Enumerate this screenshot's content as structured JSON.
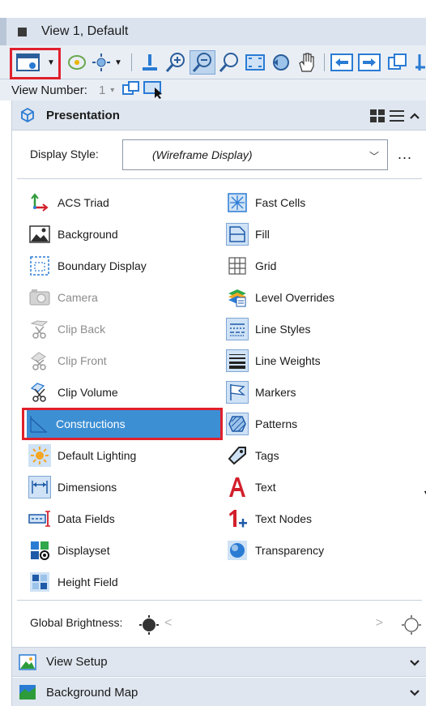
{
  "window": {
    "title": "View 1, Default"
  },
  "view_number": {
    "label": "View Number:",
    "value": "1"
  },
  "presentation": {
    "title": "Presentation",
    "display_style": {
      "label": "Display Style:",
      "value": "(Wireframe Display)"
    },
    "more_label": "...",
    "left_items": [
      {
        "label": "ACS Triad",
        "icon": "acs-triad-icon",
        "disabled": false
      },
      {
        "label": "Background",
        "icon": "background-image-icon",
        "disabled": false
      },
      {
        "label": "Boundary Display",
        "icon": "boundary-display-icon",
        "disabled": false
      },
      {
        "label": "Camera",
        "icon": "camera-icon",
        "disabled": true
      },
      {
        "label": "Clip Back",
        "icon": "clip-back-icon",
        "disabled": true
      },
      {
        "label": "Clip Front",
        "icon": "clip-front-icon",
        "disabled": true
      },
      {
        "label": "Clip Volume",
        "icon": "clip-volume-icon",
        "disabled": false
      },
      {
        "label": "Constructions",
        "icon": "constructions-icon",
        "disabled": false,
        "selected": true
      },
      {
        "label": "Default Lighting",
        "icon": "lighting-icon",
        "disabled": false
      },
      {
        "label": "Dimensions",
        "icon": "dimensions-icon",
        "disabled": false
      },
      {
        "label": "Data Fields",
        "icon": "data-fields-icon",
        "disabled": false
      },
      {
        "label": "Displayset",
        "icon": "displayset-icon",
        "disabled": false
      },
      {
        "label": "Height Field",
        "icon": "height-field-icon",
        "disabled": false
      }
    ],
    "right_items": [
      {
        "label": "Fast Cells",
        "icon": "fast-cells-icon"
      },
      {
        "label": "Fill",
        "icon": "fill-icon"
      },
      {
        "label": "Grid",
        "icon": "grid-icon"
      },
      {
        "label": "Level Overrides",
        "icon": "level-overrides-icon"
      },
      {
        "label": "Line Styles",
        "icon": "line-styles-icon"
      },
      {
        "label": "Line Weights",
        "icon": "line-weights-icon"
      },
      {
        "label": "Markers",
        "icon": "markers-icon"
      },
      {
        "label": "Patterns",
        "icon": "patterns-icon"
      },
      {
        "label": "Tags",
        "icon": "tags-icon"
      },
      {
        "label": "Text",
        "icon": "text-icon"
      },
      {
        "label": "Text Nodes",
        "icon": "text-nodes-icon"
      },
      {
        "label": "Transparency",
        "icon": "transparency-icon"
      }
    ],
    "global_brightness": {
      "label": "Global Brightness:"
    }
  },
  "view_setup": {
    "title": "View Setup"
  },
  "background_map": {
    "title": "Background Map"
  },
  "colors": {
    "selection": "#3d8fd4",
    "highlight_box": "#e0202c",
    "header_bg": "#dfe6ef"
  }
}
